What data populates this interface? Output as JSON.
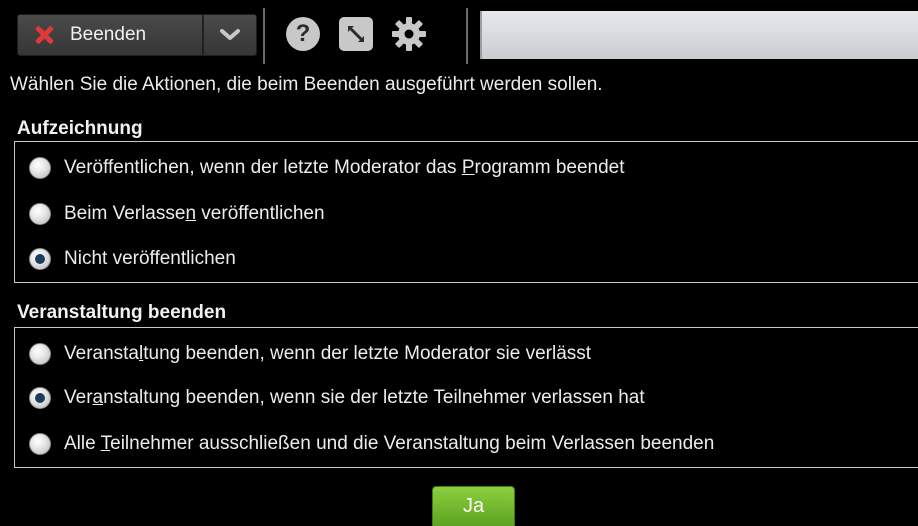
{
  "toolbar": {
    "end_button": {
      "label": "Beenden",
      "icon": "close-x-icon",
      "icon_color": "#e0393a"
    },
    "dropdown_icon": "chevron-down-icon",
    "help_icon": "help-icon",
    "expand_icon": "expand-icon",
    "settings_icon": "gear-icon"
  },
  "instruction": "Wählen Sie die Aktionen, die beim Beenden ausgeführt werden sollen.",
  "recording": {
    "title": "Aufzeichnung",
    "options": [
      {
        "before": "Veröffentlichen, wenn der letzte Moderator das ",
        "mnemonic": "P",
        "after": "rogramm beendet",
        "checked": false
      },
      {
        "before": "Beim Verlasse",
        "mnemonic": "n",
        "after": " veröffentlichen",
        "checked": false
      },
      {
        "before": "Nicht veröffentlichen",
        "mnemonic": "",
        "after": "",
        "checked": true
      }
    ]
  },
  "end_event": {
    "title": "Veranstaltung beenden",
    "options": [
      {
        "before": "Veransta",
        "mnemonic": "l",
        "after": "tung beenden, wenn der letzte Moderator sie verlässt",
        "checked": false
      },
      {
        "before": "Ver",
        "mnemonic": "a",
        "after": "nstaltung beenden, wenn sie der letzte Teilnehmer verlassen hat",
        "checked": true
      },
      {
        "before": "Alle ",
        "mnemonic": "T",
        "after": "eilnehmer ausschließen und die Veranstaltung beim Verlassen beenden",
        "checked": false
      }
    ]
  },
  "confirm_button": {
    "label": "Ja",
    "color": "#6db52b"
  }
}
